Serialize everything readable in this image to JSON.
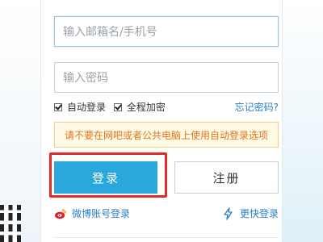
{
  "login": {
    "username_placeholder": "输入邮箱名/手机号",
    "password_placeholder": "输入密码",
    "auto_login_label": "自动登录",
    "encrypt_label": "全程加密",
    "forgot_label": "忘记密码?",
    "warning_text": "请不要在网吧或者公共电脑上使用自动登录选项",
    "login_button": "登录",
    "register_button": "注册",
    "weibo_label": "微博账号登录",
    "quick_label": "更快登录"
  },
  "icons": {
    "weibo": "weibo-icon",
    "lightning": "lightning-icon"
  },
  "colors": {
    "accent": "#2aa7dc",
    "highlight": "#e22a2a",
    "warning_text": "#e6721a",
    "link": "#2a7fc1"
  }
}
